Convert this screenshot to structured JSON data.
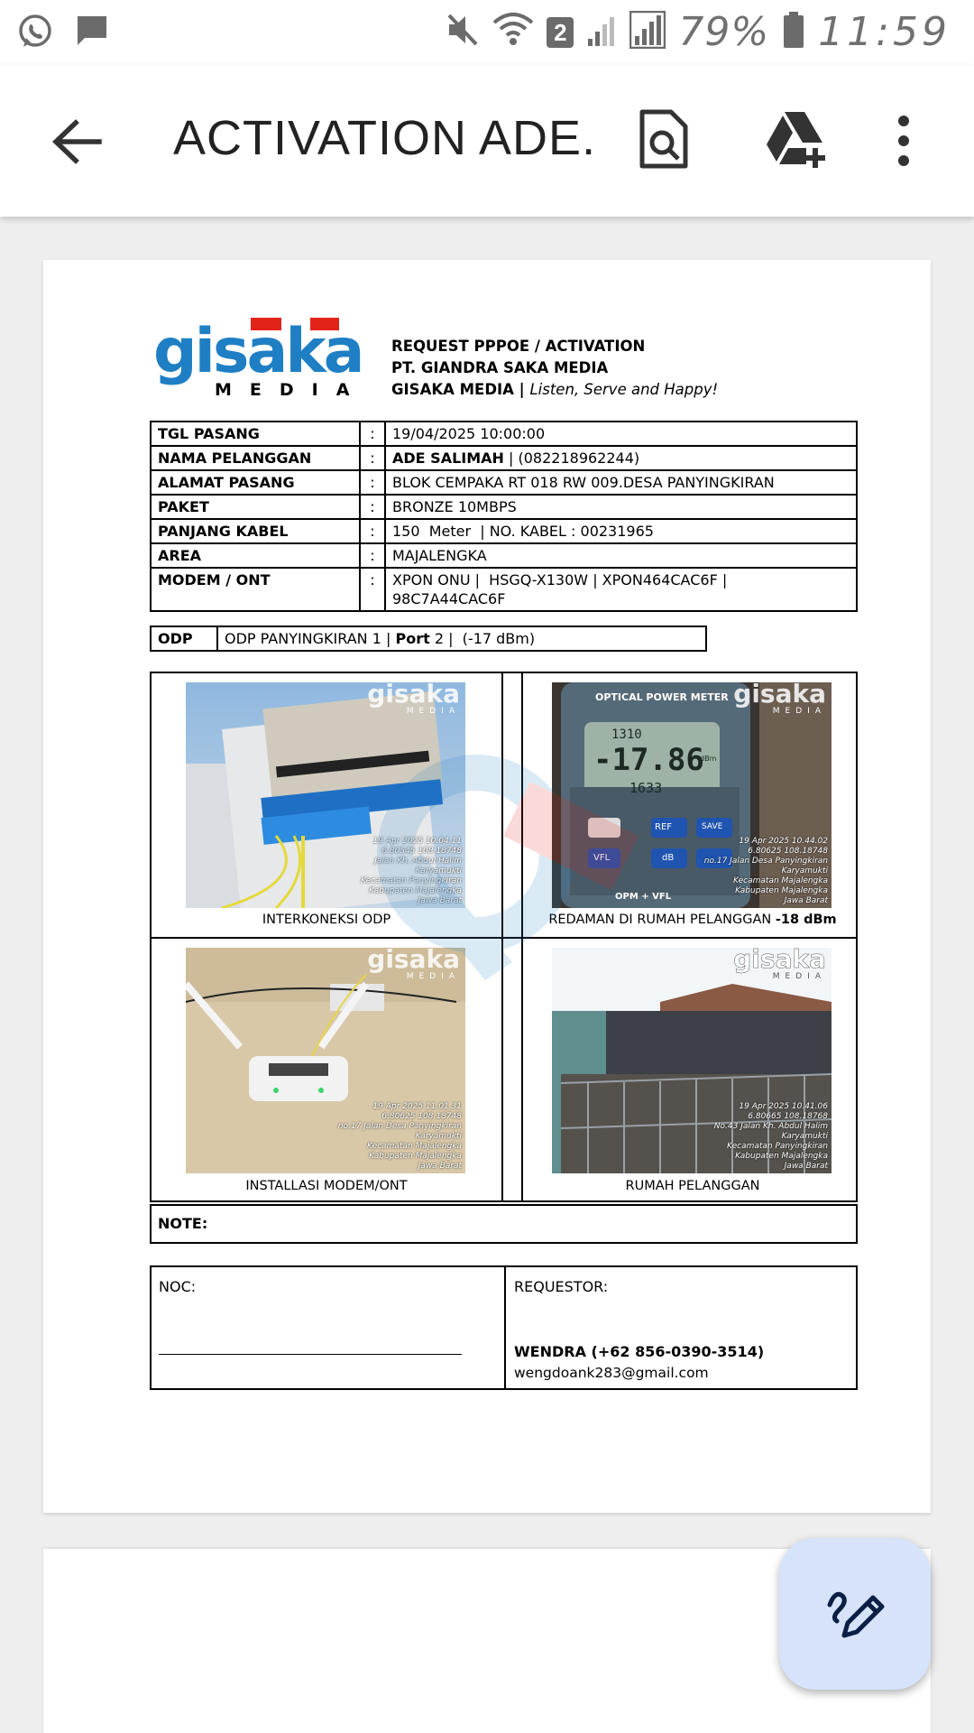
{
  "status_bar": {
    "battery": "79%",
    "time": "11:59",
    "sim_badge": "2"
  },
  "app_bar": {
    "title": "ACTIVATION ADE...",
    "icons": [
      "back-arrow-icon",
      "search-document-icon",
      "add-to-drive-icon",
      "more-vertical-icon"
    ]
  },
  "document": {
    "logo": {
      "brand": "gisaka",
      "sub": "M E D I A"
    },
    "header": {
      "line1": "REQUEST PPPOE / ACTIVATION",
      "line2": "PT. GIANDRA SAKA MEDIA",
      "line3_bold": "GISAKA MEDIA |",
      "line3_italic": "Listen, Serve and Happy!"
    },
    "info": {
      "tgl_label": "TGL PASANG",
      "tgl_value": "19/04/2025 10:00:00",
      "nama_label": "NAMA PELANGGAN",
      "nama_bold": "ADE SALIMAH",
      "nama_rest": "| (082218962244)",
      "alamat_label": "ALAMAT PASANG",
      "alamat_value": "BLOK CEMPAKA RT 018 RW 009.DESA PANYINGKIRAN",
      "paket_label": "PAKET",
      "paket_value": "BRONZE 10MBPS",
      "kabel_label": "PANJANG KABEL",
      "kabel_value": "150  Meter  | NO. KABEL : 00231965",
      "area_label": "AREA",
      "area_value": "MAJALENGKA",
      "modem_label": "MODEM / ONT",
      "modem_line1": "XPON ONU |  HSGQ-X130W | XPON464CAC6F |",
      "modem_line2": "98C7A44CAC6F",
      "colon": ":"
    },
    "odp": {
      "label": "ODP",
      "value_a": "ODP PANYINGKIRAN 1 |",
      "port_label": "Port",
      "value_b": "2 |  (-17 dBm)"
    },
    "photos": {
      "p1": {
        "caption": "INTERKONEKSI ODP",
        "stamp": [
          "19 Apr 2025 10.04.11",
          "6.80545 108.18748",
          "Jalan Kh. Abdul Halim",
          "Karyamukti",
          "Kecamatan Panyingkiran",
          "Kabupaten Majalengka",
          "Jawa Barat"
        ]
      },
      "p2": {
        "caption_a": "REDAMAN DI RUMAH PELANGGAN",
        "caption_b": "-18 dBm",
        "meter_label": "OPTICAL POWER METER",
        "meter_top": "1310",
        "meter_main": "-17.86",
        "meter_bottom": "1633",
        "meter_unit": "dBm",
        "btn_ref": "REF",
        "btn_save": "SAVE",
        "btn_vfl": "VFL",
        "btn_db": "dB",
        "brand": "OPM + VFL",
        "stamp": [
          "19 Apr 2025 10.44.02",
          "6.80625 108.18748",
          "no.17 Jalan Desa Panyingkiran",
          "Karyamukti",
          "Kecamatan Majalengka",
          "Kabupaten Majalengka",
          "Jawa Barat"
        ]
      },
      "p3": {
        "caption": "INSTALLASI MODEM/ONT",
        "stamp": [
          "19 Apr 2025 11.01.31",
          "6.80625 108.18748",
          "no.17 Jalan Desa Panyingkiran",
          "Karyamukti",
          "Kecamatan Majalengka",
          "Kabupaten Majalengka",
          "Jawa Barat"
        ]
      },
      "p4": {
        "caption": "RUMAH PELANGGAN",
        "stamp": [
          "19 Apr 2025 10.41.06",
          "6.80665 108.18768",
          "No.43 Jalan Kh. Abdul Halim",
          "Karyamukti",
          "Kecamatan Panyingkiran",
          "Kabupaten Majalengka",
          "Jawa Barat"
        ]
      }
    },
    "note_label": "NOTE:",
    "noc_label": "NOC:",
    "requestor": {
      "label": "REQUESTOR:",
      "name": "WENDRA (+62 856-0390-3514)",
      "email": "wengdoank283@gmail.com"
    }
  },
  "fab": {
    "icon": "edit-pen-icon"
  },
  "colors": {
    "logo_blue": "#1f7fc4",
    "logo_red": "#e2231a",
    "fab_bg": "#d6e3fb",
    "fab_icon": "#0b1f45"
  }
}
